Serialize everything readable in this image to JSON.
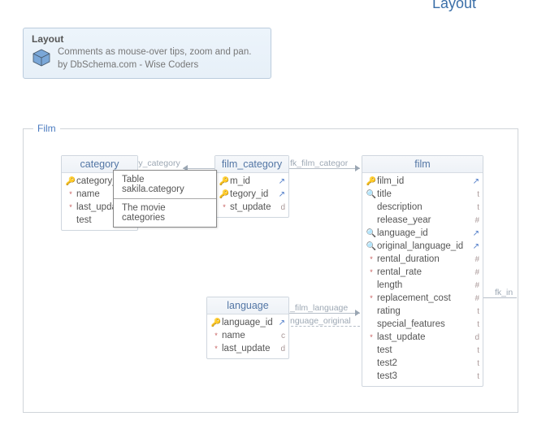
{
  "top_title": "Layout",
  "info": {
    "title": "Layout",
    "line1": "Comments as mouse-over tips, zoom and pan.",
    "line2": "by DbSchema.com - Wise Coders"
  },
  "canvas": {
    "label": "Film"
  },
  "tooltip": {
    "line1": "Table sakila.category",
    "line2": "The movie categories"
  },
  "fks": {
    "cat_filmcat": "ory_category",
    "filmcat_film": "fk_film_categor",
    "lang_film": "_film_language",
    "lang_orig": "nguage_original",
    "film_right": "fk_in"
  },
  "tables": {
    "category": {
      "title": "category",
      "cols": [
        {
          "icon": "key",
          "name": "category_",
          "mark": "arrow"
        },
        {
          "icon": "star",
          "name": "name",
          "mark": "t"
        },
        {
          "icon": "star",
          "name": "last_upda",
          "mark": "d"
        },
        {
          "icon": "blank",
          "name": "test",
          "mark": "t"
        }
      ]
    },
    "film_category": {
      "title": "film_category",
      "cols": [
        {
          "icon": "key",
          "name": "m_id",
          "mark": "arrow"
        },
        {
          "icon": "key",
          "name": "tegory_id",
          "mark": "arrow"
        },
        {
          "icon": "star",
          "name": "st_update",
          "mark": "d"
        }
      ]
    },
    "language": {
      "title": "language",
      "cols": [
        {
          "icon": "key",
          "name": "language_id",
          "mark": "arrow"
        },
        {
          "icon": "star",
          "name": "name",
          "mark": "c"
        },
        {
          "icon": "star",
          "name": "last_update",
          "mark": "d"
        }
      ]
    },
    "film": {
      "title": "film",
      "cols": [
        {
          "icon": "key",
          "name": "film_id",
          "mark": "arrow"
        },
        {
          "icon": "search",
          "name": "title",
          "mark": "t"
        },
        {
          "icon": "blank",
          "name": "description",
          "mark": "t"
        },
        {
          "icon": "blank",
          "name": "release_year",
          "mark": "#"
        },
        {
          "icon": "search",
          "name": "language_id",
          "mark": "arrow"
        },
        {
          "icon": "search",
          "name": "original_language_id",
          "mark": "arrow"
        },
        {
          "icon": "star",
          "name": "rental_duration",
          "mark": "#"
        },
        {
          "icon": "star",
          "name": "rental_rate",
          "mark": "#"
        },
        {
          "icon": "blank",
          "name": "length",
          "mark": "#"
        },
        {
          "icon": "star",
          "name": "replacement_cost",
          "mark": "#"
        },
        {
          "icon": "blank",
          "name": "rating",
          "mark": "t"
        },
        {
          "icon": "blank",
          "name": "special_features",
          "mark": "t"
        },
        {
          "icon": "star",
          "name": "last_update",
          "mark": "d"
        },
        {
          "icon": "blank",
          "name": "test",
          "mark": "t"
        },
        {
          "icon": "blank",
          "name": "test2",
          "mark": "t"
        },
        {
          "icon": "blank",
          "name": "test3",
          "mark": "t"
        }
      ]
    }
  }
}
